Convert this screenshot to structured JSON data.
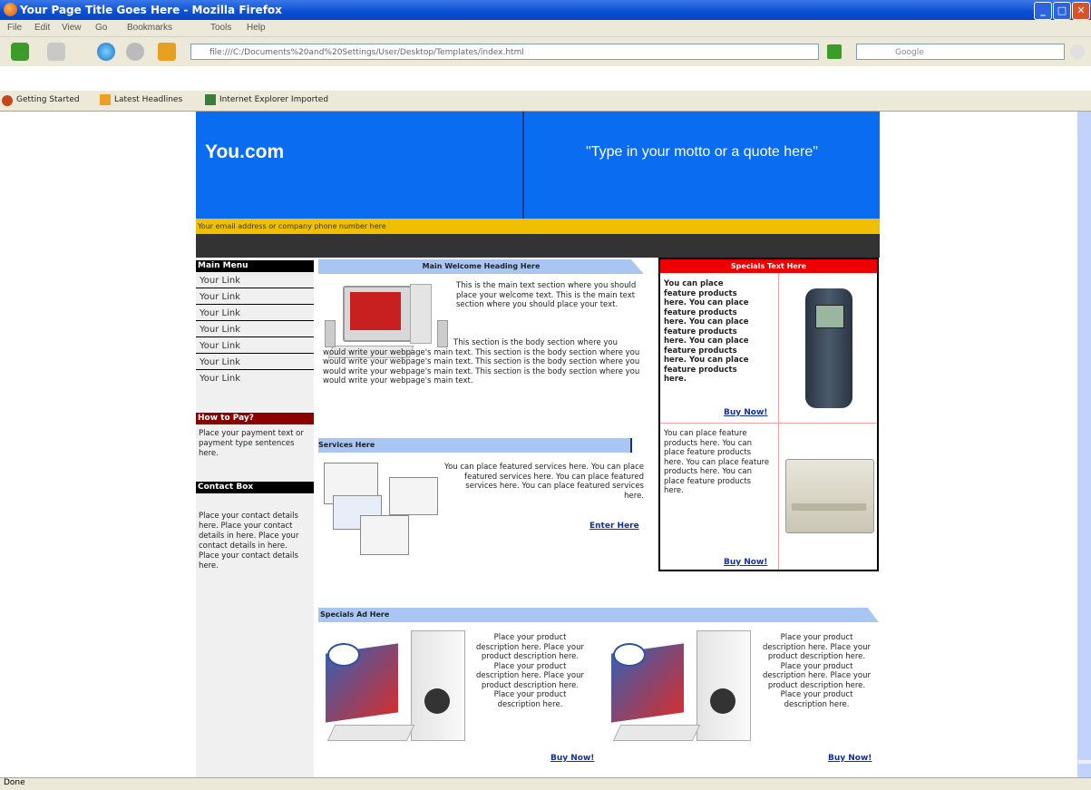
{
  "browser": {
    "title": "Your Page Title Goes Here - Mozilla Firefox",
    "menu": [
      "File",
      "Edit",
      "View",
      "Go",
      "Bookmarks",
      "Tools",
      "Help"
    ],
    "url": "file:///C:/Documents%20and%20Settings/User/Desktop/Templates/index.html",
    "search_placeholder": "Google",
    "bookmarks": [
      "Getting Started",
      "Latest Headlines",
      "Internet Explorer Imported"
    ],
    "status": "Done"
  },
  "page": {
    "site_name": "You.com",
    "motto": "\"Type in your motto or a quote here\"",
    "phone_bar": "Your email address or company phone number here",
    "main_menu": {
      "title": "Main Menu",
      "links": [
        "Your Link",
        "Your Link",
        "Your Link",
        "Your Link",
        "Your Link",
        "Your Link",
        "Your Link"
      ]
    },
    "how_to_pay": {
      "title": "How to Pay?",
      "text": "Place your payment text or payment type sentences here."
    },
    "contact_box": {
      "title": "Contact Box",
      "text": "Place your contact details here. Place your contact details in here. Place your contact details in here. Place your contact details here."
    },
    "welcome": {
      "heading": "Main Welcome Heading Here",
      "text1": "This is the main text section where you should place your welcome text. This is the main text section where you should place your text.",
      "text2": "This section is the body section where you would write your webpage's main text. This section is the body section where you would write your webpage's main text. This section is the body section where you would write your webpage's main text. This section is the body section where you would write your webpage's main text."
    },
    "services": {
      "heading": "Services Here",
      "text": "You can place featured services here. You can place featured services here. You can place featured services here. You can place featured services here.",
      "link": "Enter Here"
    },
    "specials_text": {
      "heading": "Specials Text Here",
      "product1_text": "You can place feature products here. You can place feature products here. You can place feature products here. You can place feature products here. You can place feature products here.",
      "product1_link": "Buy Now!",
      "product2_text": "You can place feature products here. You can place feature products here. You can place feature products here. You can place feature products here.",
      "product2_link": "Buy Now!"
    },
    "specials_ad": {
      "heading": "Specials Ad Here",
      "item1_text": "Place your product description here. Place your product description here. Place your product description here. Place your product description here. Place your product description here.",
      "item1_link": "Buy Now!",
      "item2_text": "Place your product description here. Place your product description here. Place your product description here. Place your product description here. Place your product description here.",
      "item2_link": "Buy Now!"
    }
  }
}
